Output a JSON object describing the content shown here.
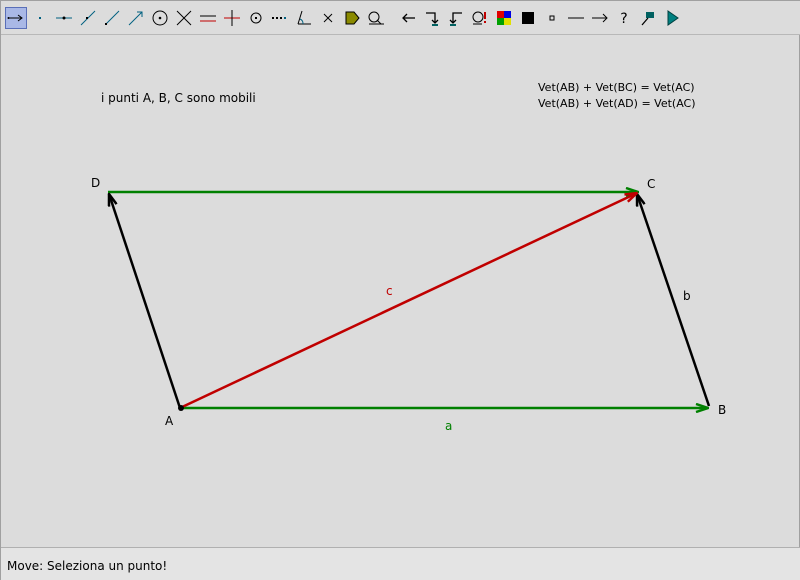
{
  "toolbar": {
    "tools": [
      {
        "id": "move",
        "icon": "move-arrow-icon",
        "selected": true
      },
      {
        "id": "point",
        "icon": "point-icon"
      },
      {
        "id": "line",
        "icon": "line-icon"
      },
      {
        "id": "segment",
        "icon": "segment-icon"
      },
      {
        "id": "ray",
        "icon": "ray-icon"
      },
      {
        "id": "vector",
        "icon": "vector-icon"
      },
      {
        "id": "circle",
        "icon": "circle-icon"
      },
      {
        "id": "intersect",
        "icon": "intersect-icon"
      },
      {
        "id": "parallel",
        "icon": "parallel-icon"
      },
      {
        "id": "perpendicular",
        "icon": "perpendicular-icon"
      },
      {
        "id": "midpoint",
        "icon": "midpoint-icon"
      },
      {
        "id": "dotted-line",
        "icon": "dotted-line-icon"
      },
      {
        "id": "angle",
        "icon": "angle-icon"
      },
      {
        "id": "delete",
        "icon": "delete-x-icon"
      },
      {
        "id": "label",
        "icon": "label-tag-icon"
      },
      {
        "id": "measure",
        "icon": "measure-icon"
      },
      {
        "id": "undo",
        "icon": "undo-arrow-icon"
      },
      {
        "id": "redo",
        "icon": "redo-arrow-icon"
      },
      {
        "id": "redo-back",
        "icon": "redo-back-icon"
      },
      {
        "id": "find",
        "icon": "find-icon"
      },
      {
        "id": "color",
        "icon": "color-palette-icon"
      },
      {
        "id": "fill",
        "icon": "filled-square-icon"
      },
      {
        "id": "small-point",
        "icon": "small-square-icon"
      },
      {
        "id": "plain-line",
        "icon": "plain-line-icon"
      },
      {
        "id": "arrow-line",
        "icon": "arrow-line-icon"
      },
      {
        "id": "help",
        "icon": "question-icon"
      },
      {
        "id": "macro",
        "icon": "macro-icon"
      },
      {
        "id": "run",
        "icon": "play-icon"
      }
    ]
  },
  "canvas": {
    "note": "i punti A, B, C sono mobili",
    "formula_1": "Vet(AB) + Vet(BC) = Vet(AC)",
    "formula_2": "Vet(AB) + Vet(AD) = Vet(AC)",
    "points": {
      "A": "A",
      "B": "B",
      "C": "C",
      "D": "D"
    },
    "vector_labels": {
      "a": "a",
      "b": "b",
      "c": "c"
    },
    "colors": {
      "green": "#008000",
      "black": "#000000",
      "red": "#c00000",
      "background": "#dcdcdc"
    }
  },
  "statusbar": {
    "text": "Move: Seleziona un punto!"
  }
}
